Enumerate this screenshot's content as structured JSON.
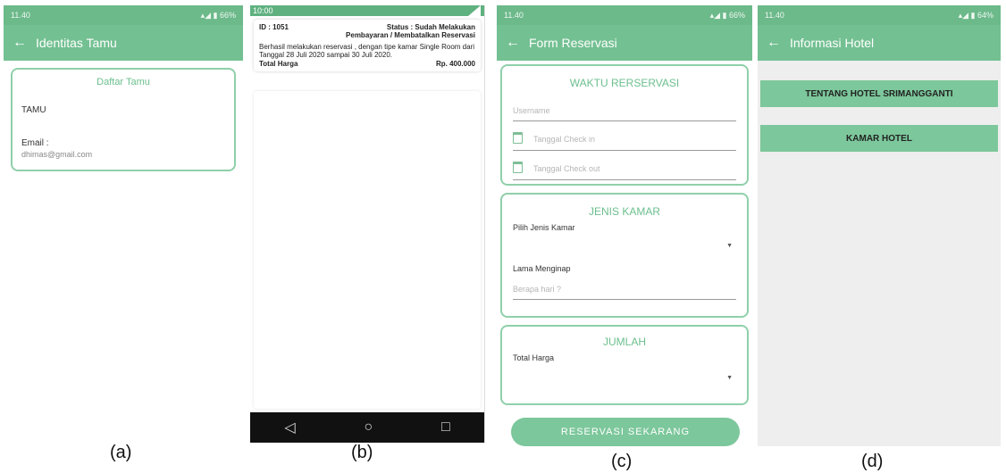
{
  "phone_a": {
    "status_time": "11.40",
    "status_right": "66%",
    "appbar_title": "Identitas Tamu",
    "card_title": "Daftar Tamu",
    "name": "TAMU",
    "email_label": "Email :",
    "email_value": "dhimas@gmail.com",
    "caption": "(a)"
  },
  "phone_b": {
    "status_time": "10:00",
    "id_text": "ID : 1051",
    "status_line1": "Status : Sudah Melakukan",
    "status_line2": "Pembayaran / Membatalkan Reservasi",
    "message": "Berhasil melakukan reservasi , dengan tipe kamar Single Room dari Tanggal 28 Juli 2020 sampai 30 Juli 2020.",
    "total_label": "Total Harga",
    "total_value": "Rp. 400.000",
    "nav_back": "◁",
    "nav_home": "○",
    "nav_recent": "□",
    "caption": "(b)"
  },
  "phone_c": {
    "status_time": "11.40",
    "status_right": "66%",
    "appbar_title": "Form Reservasi",
    "waktu_title": "WAKTU RERSERVASI",
    "username_placeholder": "Username",
    "checkin_placeholder": "Tanggal Check in",
    "checkout_placeholder": "Tanggal Check out",
    "jenis_title": "JENIS KAMAR",
    "pilih_label": "Pilih Jenis Kamar",
    "lama_label": "Lama Menginap",
    "lama_placeholder": "Berapa hari ?",
    "jumlah_title": "JUMLAH",
    "total_label": "Total Harga",
    "submit_button": "RESERVASI SEKARANG",
    "caption": "(c)"
  },
  "phone_d": {
    "status_time": "11.40",
    "status_right": "64%",
    "appbar_title": "Informasi Hotel",
    "btn_tentang": "TENTANG HOTEL SRIMANGGANTI",
    "btn_kamar": "KAMAR HOTEL",
    "caption": "(d)"
  },
  "colors": {
    "primary": "#73c092",
    "status": "#6cb98a",
    "border": "#8fd0aa"
  },
  "icons": [
    "back-arrow-icon",
    "calendar-icon",
    "dropdown-arrow-icon",
    "signal-icon",
    "battery-icon"
  ]
}
